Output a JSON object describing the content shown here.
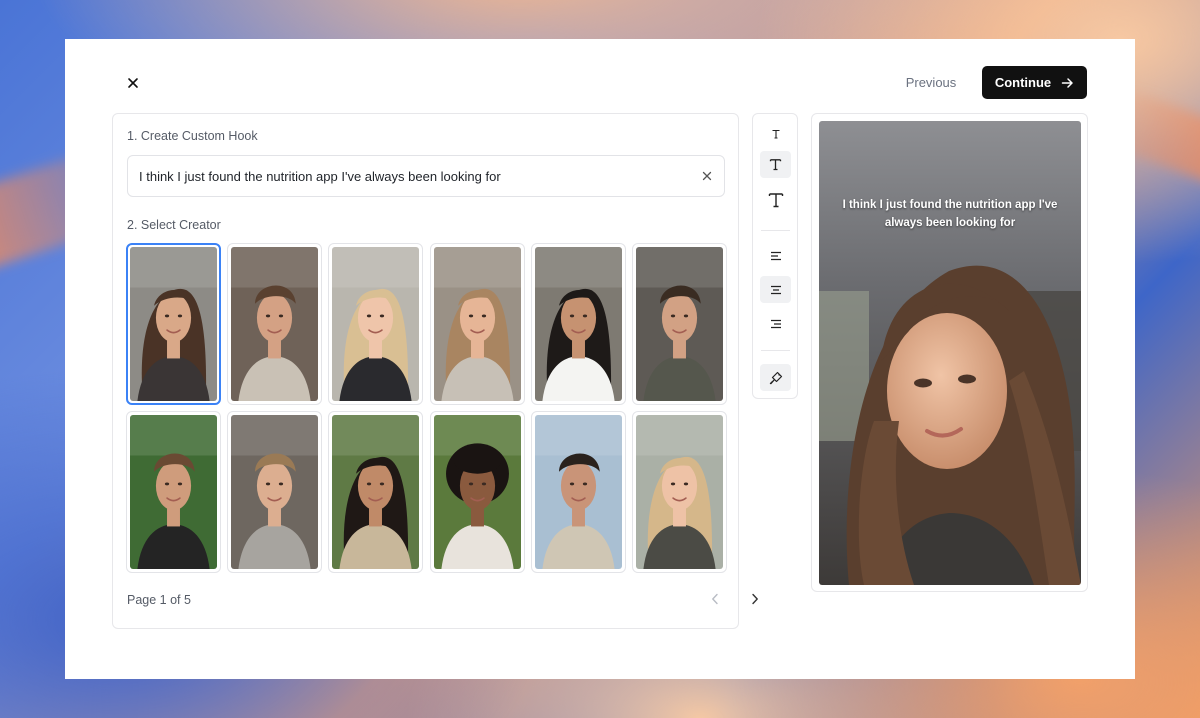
{
  "nav": {
    "previous_label": "Previous",
    "continue_label": "Continue"
  },
  "hook": {
    "section_label": "1. Create Custom Hook",
    "value": "I think I just found the nutrition app I've always been looking for"
  },
  "creators": {
    "section_label": "2. Select Creator",
    "selected_index": 0,
    "items": [
      {
        "bg": "#8d8b86",
        "skin": "#d9a888",
        "hair": "#4a3326",
        "shirt": "#3a3535",
        "style": "long"
      },
      {
        "bg": "#6f6258",
        "skin": "#d4a184",
        "hair": "#5a4130",
        "shirt": "#c9c1b5",
        "style": "short"
      },
      {
        "bg": "#b9b6ae",
        "skin": "#efc5aa",
        "hair": "#d9bf93",
        "shirt": "#2a2a2e",
        "style": "long"
      },
      {
        "bg": "#9a9186",
        "skin": "#e6b596",
        "hair": "#a98561",
        "shirt": "#c7c0b6",
        "style": "long"
      },
      {
        "bg": "#7e7a72",
        "skin": "#c69271",
        "hair": "#1e1a18",
        "shirt": "#f4f4f2",
        "style": "long"
      },
      {
        "bg": "#5e5a55",
        "skin": "#d2a184",
        "hair": "#3a2c22",
        "shirt": "#55574d",
        "style": "short"
      },
      {
        "bg": "#3f6b34",
        "skin": "#cf9c7c",
        "hair": "#6a4a33",
        "shirt": "#242424",
        "style": "short"
      },
      {
        "bg": "#6e6760",
        "skin": "#dcae90",
        "hair": "#9a7a55",
        "shirt": "#a7a49f",
        "style": "short"
      },
      {
        "bg": "#5f7a45",
        "skin": "#c08a68",
        "hair": "#1f1815",
        "shirt": "#c8b79a",
        "style": "long"
      },
      {
        "bg": "#5b7a3c",
        "skin": "#8a5a3e",
        "hair": "#1a1412",
        "shirt": "#e8e3dc",
        "style": "curly"
      },
      {
        "bg": "#a9bfd2",
        "skin": "#c99478",
        "hair": "#2a221d",
        "shirt": "#cfc6b4",
        "style": "short"
      },
      {
        "bg": "#aab0a6",
        "skin": "#eec2a6",
        "hair": "#d5b78a",
        "shirt": "#4b4b45",
        "style": "long"
      }
    ]
  },
  "pagination": {
    "label": "Page 1 of 5"
  },
  "toolbar": {
    "tools": [
      {
        "name": "text-size-small-icon",
        "active": false
      },
      {
        "name": "text-size-medium-icon",
        "active": true
      },
      {
        "name": "text-size-large-icon",
        "active": false
      },
      {
        "name": "align-left-icon",
        "active": false
      },
      {
        "name": "align-center-icon",
        "active": true
      },
      {
        "name": "align-right-icon",
        "active": false
      },
      {
        "name": "paint-brush-icon",
        "active": true
      }
    ]
  },
  "preview": {
    "caption": "I think I just found the nutrition app I've always been looking for"
  },
  "colors": {
    "accent": "#3b82f6",
    "primary_button": "#111111"
  }
}
